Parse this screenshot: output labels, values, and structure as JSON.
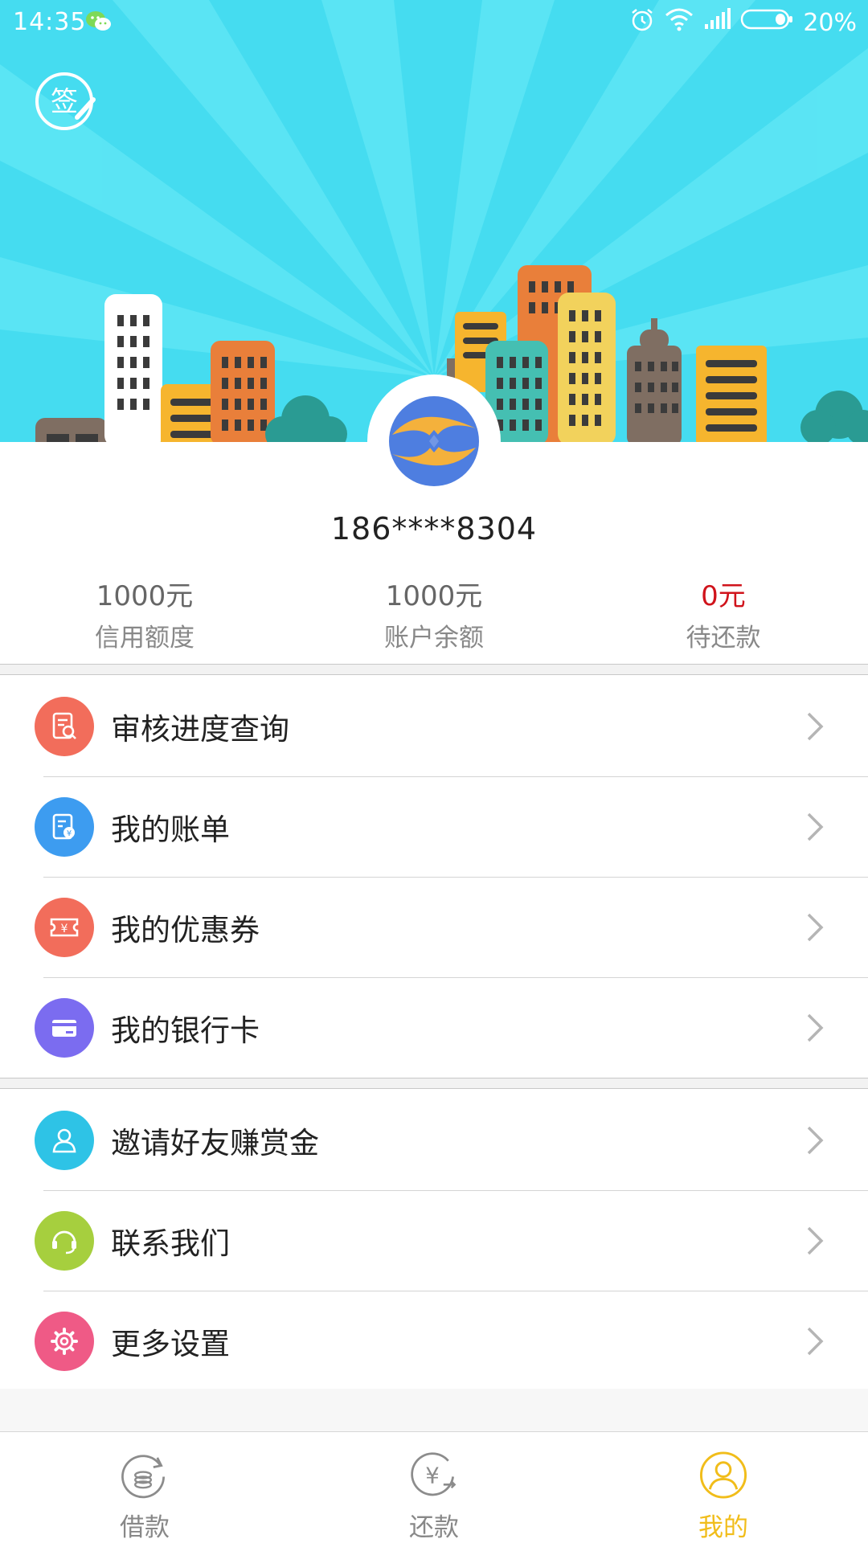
{
  "status_bar": {
    "time": "14:35",
    "battery": "20%"
  },
  "user": {
    "phone": "186****8304"
  },
  "stats": [
    {
      "value": "1000元",
      "label": "信用额度"
    },
    {
      "value": "1000元",
      "label": "账户余额"
    },
    {
      "value": "0元",
      "label": "待还款"
    }
  ],
  "menu_group_1": [
    {
      "label": "审核进度查询",
      "icon": "review-progress-icon",
      "color": "#f26d5b"
    },
    {
      "label": "我的账单",
      "icon": "bill-icon",
      "color": "#3d9cf0"
    },
    {
      "label": "我的优惠券",
      "icon": "coupon-icon",
      "color": "#f26d5b"
    },
    {
      "label": "我的银行卡",
      "icon": "bank-card-icon",
      "color": "#7b6cf0"
    }
  ],
  "menu_group_2": [
    {
      "label": "邀请好友赚赏金",
      "icon": "invite-friend-icon",
      "color": "#2ec3e6"
    },
    {
      "label": "联系我们",
      "icon": "headset-icon",
      "color": "#a6cf3e"
    },
    {
      "label": "更多设置",
      "icon": "gear-icon",
      "color": "#ef5a86"
    }
  ],
  "tabs": [
    {
      "label": "借款",
      "icon": "borrow-icon"
    },
    {
      "label": "还款",
      "icon": "repay-icon"
    },
    {
      "label": "我的",
      "icon": "profile-icon",
      "active": true
    }
  ],
  "sign_button": {
    "text": "签"
  },
  "colors": {
    "hero_bg": "#45dcf0",
    "accent_active": "#f1bd1a",
    "owed_red": "#d0131b"
  }
}
